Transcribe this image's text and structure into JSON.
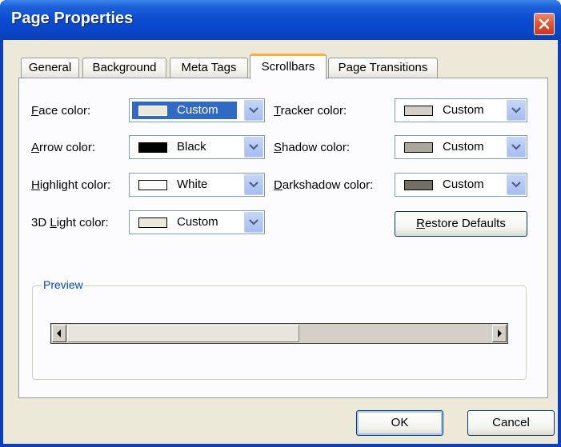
{
  "window": {
    "title": "Page Properties"
  },
  "tabs": [
    {
      "label": "General"
    },
    {
      "label": "Background"
    },
    {
      "label": "Meta Tags"
    },
    {
      "label": "Scrollbars",
      "active": true
    },
    {
      "label": "Page Transitions"
    }
  ],
  "fields": {
    "face": {
      "label_key": "F",
      "label_rest": "ace color:",
      "value": "Custom",
      "swatch": "#ece9d8"
    },
    "arrow": {
      "label_key": "A",
      "label_rest": "rrow color:",
      "value": "Black",
      "swatch": "#000000"
    },
    "highlight": {
      "label_key": "H",
      "label_rest": "ighlight color:",
      "value": "White",
      "swatch": "#ffffff"
    },
    "light3d": {
      "label_pre": "3D ",
      "label_key": "L",
      "label_rest": "ight color:",
      "value": "Custom",
      "swatch": "#ece9d8"
    },
    "tracker": {
      "label_key": "T",
      "label_rest": "racker color:",
      "value": "Custom",
      "swatch": "#d4d0c8"
    },
    "shadow": {
      "label_key": "S",
      "label_rest": "hadow color:",
      "value": "Custom",
      "swatch": "#aca899"
    },
    "darkshadow": {
      "label_key": "D",
      "label_rest": "arkshadow color:",
      "value": "Custom",
      "swatch": "#716f64"
    }
  },
  "buttons": {
    "restore_key": "R",
    "restore_rest": "estore Defaults",
    "ok": "OK",
    "cancel": "Cancel"
  },
  "preview": {
    "title": "Preview",
    "scroll_position": 0
  },
  "colors": {
    "title_bar": "#0b4bd0",
    "accent_tab": "#f9b239",
    "selection": "#316ac5"
  }
}
